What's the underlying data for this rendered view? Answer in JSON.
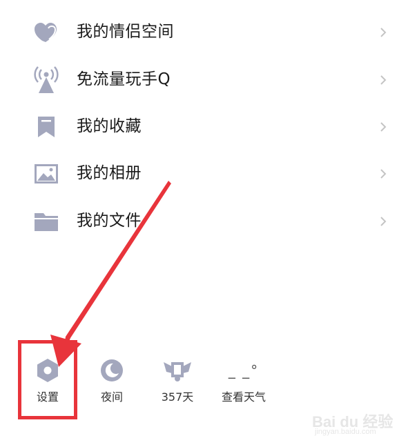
{
  "menu": {
    "items": [
      {
        "icon": "couple-heart-icon",
        "label": "我的情侣空间"
      },
      {
        "icon": "signal-tower-icon",
        "label": "免流量玩手Q"
      },
      {
        "icon": "bookmark-icon",
        "label": "我的收藏"
      },
      {
        "icon": "photo-album-icon",
        "label": "我的相册"
      },
      {
        "icon": "folder-icon",
        "label": "我的文件"
      }
    ]
  },
  "bottom_bar": {
    "items": [
      {
        "icon": "settings-hexagon-icon",
        "label": "设置"
      },
      {
        "icon": "moon-night-icon",
        "label": "夜间"
      },
      {
        "icon": "winged-badge-icon",
        "label": "357天"
      },
      {
        "icon": "weather-icon",
        "label": "查看天气",
        "icon_text": "_ _°"
      }
    ]
  },
  "annotation": {
    "highlight_color": "#e8343b"
  },
  "watermark": {
    "main": "Bai du 经验",
    "sub": "jingyan.baidu.com"
  },
  "colors": {
    "icon_gray": "#a3a7bd",
    "label_dark": "#1a1a1a",
    "chevron": "#c4c4c4"
  }
}
